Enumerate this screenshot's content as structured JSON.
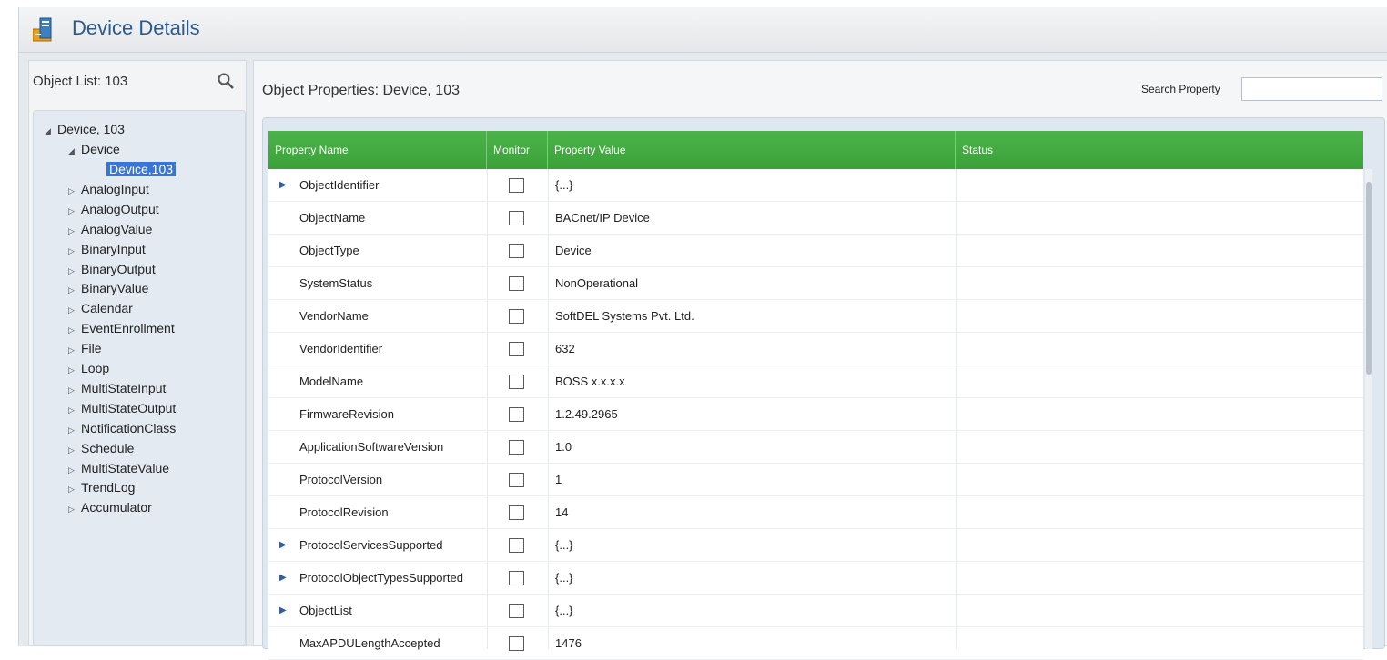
{
  "window": {
    "title": "Device Details",
    "colors": {
      "title_text": "#2a5b8f",
      "grid_header": "#3fa63d",
      "selection": "#3875d7"
    }
  },
  "object_list": {
    "label": "Object List: 103",
    "tree": [
      {
        "label": "Device, 103",
        "expanded": true
      },
      {
        "label": "Device",
        "expanded": true
      },
      {
        "label": "Device,103",
        "selected": true
      },
      {
        "label": "AnalogInput"
      },
      {
        "label": "AnalogOutput"
      },
      {
        "label": "AnalogValue"
      },
      {
        "label": "BinaryInput"
      },
      {
        "label": "BinaryOutput"
      },
      {
        "label": "BinaryValue"
      },
      {
        "label": "Calendar"
      },
      {
        "label": "EventEnrollment"
      },
      {
        "label": "File"
      },
      {
        "label": "Loop"
      },
      {
        "label": "MultiStateInput"
      },
      {
        "label": "MultiStateOutput"
      },
      {
        "label": "NotificationClass"
      },
      {
        "label": "Schedule"
      },
      {
        "label": "MultiStateValue"
      },
      {
        "label": "TrendLog"
      },
      {
        "label": "Accumulator"
      }
    ]
  },
  "object_properties": {
    "label": "Object Properties: Device, 103",
    "search_label": "Search Property",
    "search_value": "",
    "columns": [
      "Property Name",
      "Monitor",
      "Property Value",
      "Status"
    ],
    "rows": [
      {
        "name": "ObjectIdentifier",
        "value": "{...}",
        "expandable": true,
        "monitor": false
      },
      {
        "name": "ObjectName",
        "value": "BACnet/IP Device",
        "expandable": false,
        "monitor": false
      },
      {
        "name": "ObjectType",
        "value": "Device",
        "expandable": false,
        "monitor": false
      },
      {
        "name": "SystemStatus",
        "value": "NonOperational",
        "expandable": false,
        "monitor": false
      },
      {
        "name": "VendorName",
        "value": "SoftDEL Systems Pvt. Ltd.",
        "expandable": false,
        "monitor": false
      },
      {
        "name": "VendorIdentifier",
        "value": "632",
        "expandable": false,
        "monitor": false
      },
      {
        "name": "ModelName",
        "value": "BOSS x.x.x.x",
        "expandable": false,
        "monitor": false
      },
      {
        "name": "FirmwareRevision",
        "value": "1.2.49.2965",
        "expandable": false,
        "monitor": false
      },
      {
        "name": "ApplicationSoftwareVersion",
        "value": "1.0",
        "expandable": false,
        "monitor": false
      },
      {
        "name": "ProtocolVersion",
        "value": "1",
        "expandable": false,
        "monitor": false
      },
      {
        "name": "ProtocolRevision",
        "value": "14",
        "expandable": false,
        "monitor": false
      },
      {
        "name": "ProtocolServicesSupported",
        "value": "{...}",
        "expandable": true,
        "monitor": false
      },
      {
        "name": "ProtocolObjectTypesSupported",
        "value": "{...}",
        "expandable": true,
        "monitor": false
      },
      {
        "name": "ObjectList",
        "value": "{...}",
        "expandable": true,
        "monitor": false
      },
      {
        "name": "MaxAPDULengthAccepted",
        "value": "1476",
        "expandable": false,
        "monitor": false
      }
    ]
  }
}
